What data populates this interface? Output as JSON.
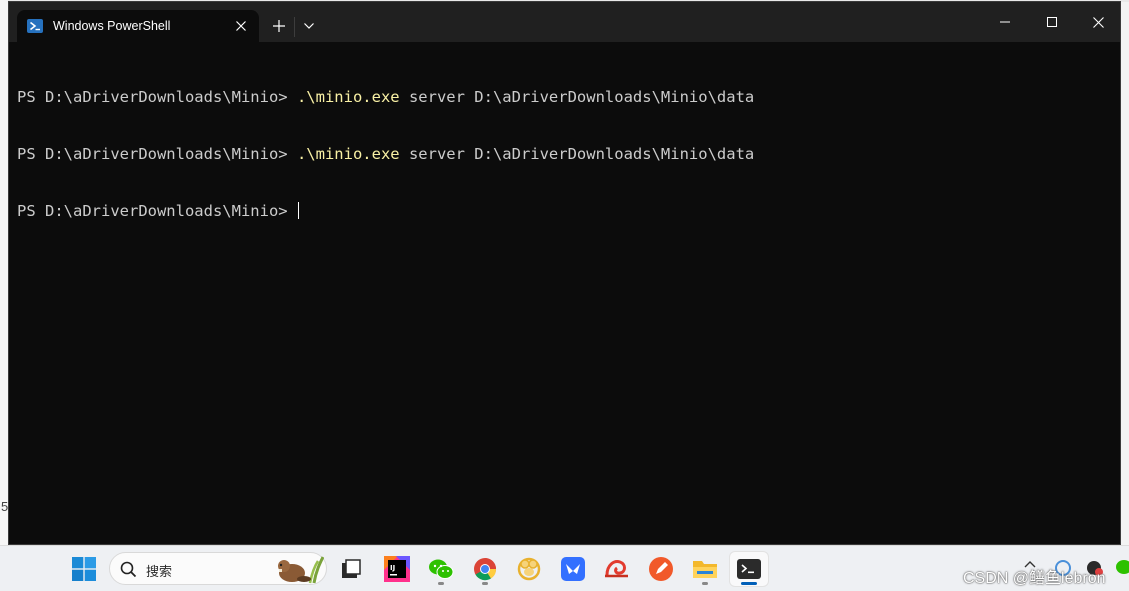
{
  "background": {
    "edge_number": "5"
  },
  "window": {
    "tab_title": "Windows PowerShell"
  },
  "terminal": {
    "lines": [
      {
        "prompt": "PS D:\\aDriverDownloads\\Minio> ",
        "command": ".\\minio.exe",
        "args": " server D:\\aDriverDownloads\\Minio\\data"
      },
      {
        "prompt": "PS D:\\aDriverDownloads\\Minio> ",
        "command": ".\\minio.exe",
        "args": " server D:\\aDriverDownloads\\Minio\\data"
      },
      {
        "prompt": "PS D:\\aDriverDownloads\\Minio> ",
        "command": "",
        "args": ""
      }
    ]
  },
  "taskbar": {
    "search_text": "搜索",
    "watermark": "CSDN @鳝鱼lebron",
    "apps": [
      "windows-start-icon",
      "file-manager-icon",
      "jetbrains-icon",
      "wechat-icon",
      "chrome-icon",
      "navicat-icon",
      "feishu-icon",
      "snail-app-icon",
      "pen-app-icon",
      "file-explorer-icon",
      "terminal-icon"
    ]
  },
  "colors": {
    "terminal_bg": "#0c0c0c",
    "titlebar_bg": "#202020",
    "command_color": "#f9f1a5",
    "text_color": "#cccccc",
    "taskbar_bg": "#eef0f3"
  }
}
